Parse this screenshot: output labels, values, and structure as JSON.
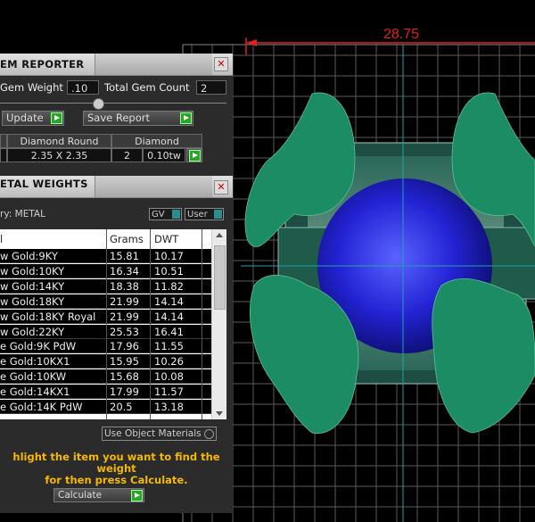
{
  "viewport": {
    "dimension_value": "28.75"
  },
  "gem_reporter": {
    "title": "EM REPORTER",
    "gem_weight_label": "Gem Weight",
    "gem_weight_value": ".10",
    "total_gem_count_label": "Total Gem Count",
    "total_gem_count_value": "2",
    "update_label": "Update",
    "save_report_label": "Save Report",
    "table_headers": [
      "Diamond Round",
      "Diamond"
    ],
    "row": {
      "size": "2.35 X 2.35",
      "count": "2",
      "weight": "0.10tw"
    }
  },
  "metal_weights": {
    "title": "ETAL WEIGHTS",
    "category_label": "ry: METAL",
    "gv_label": "GV",
    "user_label": "User",
    "columns": [
      "l",
      "Grams",
      "DWT"
    ],
    "rows": [
      {
        "name": "w Gold:9KY",
        "grams": "15.81",
        "dwt": "10.17"
      },
      {
        "name": "w Gold:10KY",
        "grams": "16.34",
        "dwt": "10.51"
      },
      {
        "name": "w Gold:14KY",
        "grams": "18.38",
        "dwt": "11.82"
      },
      {
        "name": "w Gold:18KY",
        "grams": "21.99",
        "dwt": "14.14"
      },
      {
        "name": "w Gold:18KY Royal",
        "grams": "21.99",
        "dwt": "14.14"
      },
      {
        "name": "w Gold:22KY",
        "grams": "25.53",
        "dwt": "16.41"
      },
      {
        "name": "e Gold:9K PdW",
        "grams": "17.96",
        "dwt": "11.55"
      },
      {
        "name": "e Gold:10KX1",
        "grams": "15.95",
        "dwt": "10.26"
      },
      {
        "name": "e Gold:10KW",
        "grams": "15.68",
        "dwt": "10.08"
      },
      {
        "name": "e Gold:14KX1",
        "grams": "17.99",
        "dwt": "11.57"
      },
      {
        "name": "e Gold:14K PdW",
        "grams": "20.5",
        "dwt": "13.18"
      }
    ],
    "use_object_materials_label": "Use Object Materials",
    "hint_line1": "hlight the item you want to find the weight",
    "hint_line2": "for then press Calculate.",
    "calculate_label": "Calculate"
  }
}
